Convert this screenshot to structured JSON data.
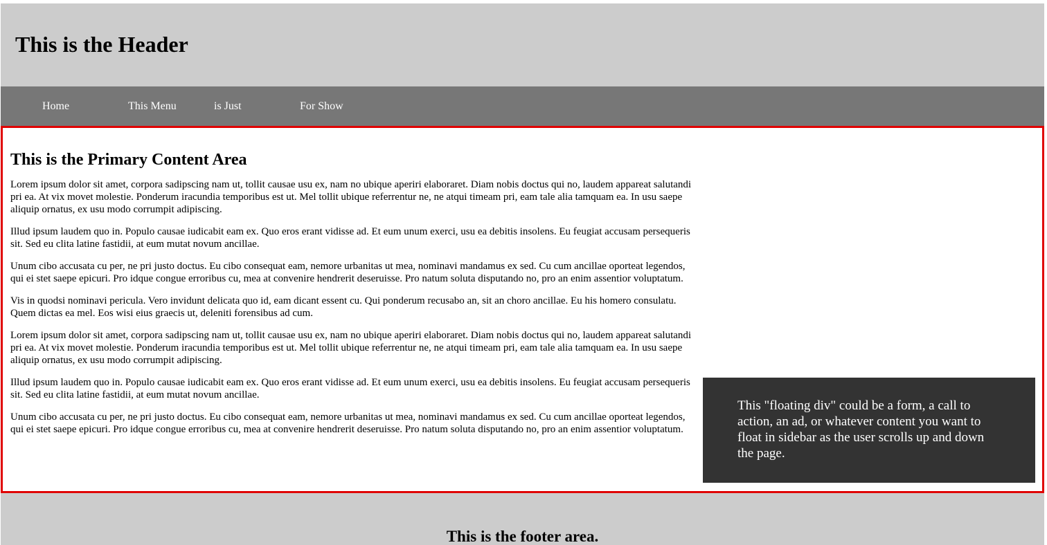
{
  "header": {
    "title": "This is the Header"
  },
  "nav": {
    "items": [
      {
        "label": "Home"
      },
      {
        "label": "This Menu"
      },
      {
        "label": "is Just"
      },
      {
        "label": "For Show"
      }
    ]
  },
  "main": {
    "title": "This is the Primary Content Area",
    "paragraphs": [
      "Lorem ipsum dolor sit amet, corpora sadipscing nam ut, tollit causae usu ex, nam no ubique aperiri elaboraret. Diam nobis doctus qui no, laudem appareat salutandi pri ea. At vix movet molestie. Ponderum iracundia temporibus est ut. Mel tollit ubique referrentur ne, ne atqui timeam pri, eam tale alia tamquam ea. In usu saepe aliquip ornatus, ex usu modo corrumpit adipiscing.",
      "Illud ipsum laudem quo in. Populo causae iudicabit eam ex. Quo eros erant vidisse ad. Et eum unum exerci, usu ea debitis insolens. Eu feugiat accusam persequeris sit. Sed eu clita latine fastidii, at eum mutat novum ancillae.",
      "Unum cibo accusata cu per, ne pri justo doctus. Eu cibo consequat eam, nemore urbanitas ut mea, nominavi mandamus ex sed. Cu cum ancillae oporteat legendos, qui ei stet saepe epicuri. Pro idque congue erroribus cu, mea at convenire hendrerit deseruisse. Pro natum soluta disputando no, pro an enim assentior voluptatum.",
      "Vis in quodsi nominavi pericula. Vero invidunt delicata quo id, eam dicant essent cu. Qui ponderum recusabo an, sit an choro ancillae. Eu his homero consulatu. Quem dictas ea mel. Eos wisi eius graecis ut, deleniti forensibus ad cum.",
      "Lorem ipsum dolor sit amet, corpora sadipscing nam ut, tollit causae usu ex, nam no ubique aperiri elaboraret. Diam nobis doctus qui no, laudem appareat salutandi pri ea. At vix movet molestie. Ponderum iracundia temporibus est ut. Mel tollit ubique referrentur ne, ne atqui timeam pri, eam tale alia tamquam ea. In usu saepe aliquip ornatus, ex usu modo corrumpit adipiscing.",
      "Illud ipsum laudem quo in. Populo causae iudicabit eam ex. Quo eros erant vidisse ad. Et eum unum exerci, usu ea debitis insolens. Eu feugiat accusam persequeris sit. Sed eu clita latine fastidii, at eum mutat novum ancillae.",
      "Unum cibo accusata cu per, ne pri justo doctus. Eu cibo consequat eam, nemore urbanitas ut mea, nominavi mandamus ex sed. Cu cum ancillae oporteat legendos, qui ei stet saepe epicuri. Pro idque congue erroribus cu, mea at convenire hendrerit deseruisse. Pro natum soluta disputando no, pro an enim assentior voluptatum."
    ]
  },
  "sidebar": {
    "floating_text": "This \"floating div\" could be a form, a call to action, an ad, or whatever content you want to float in sidebar as the user scrolls up and down the page."
  },
  "footer": {
    "text": "This is the footer area."
  },
  "colors": {
    "header_bg": "#cccccc",
    "nav_bg": "#777777",
    "content_border": "#e00000",
    "floating_bg": "#333333",
    "footer_bg": "#cccccc"
  }
}
